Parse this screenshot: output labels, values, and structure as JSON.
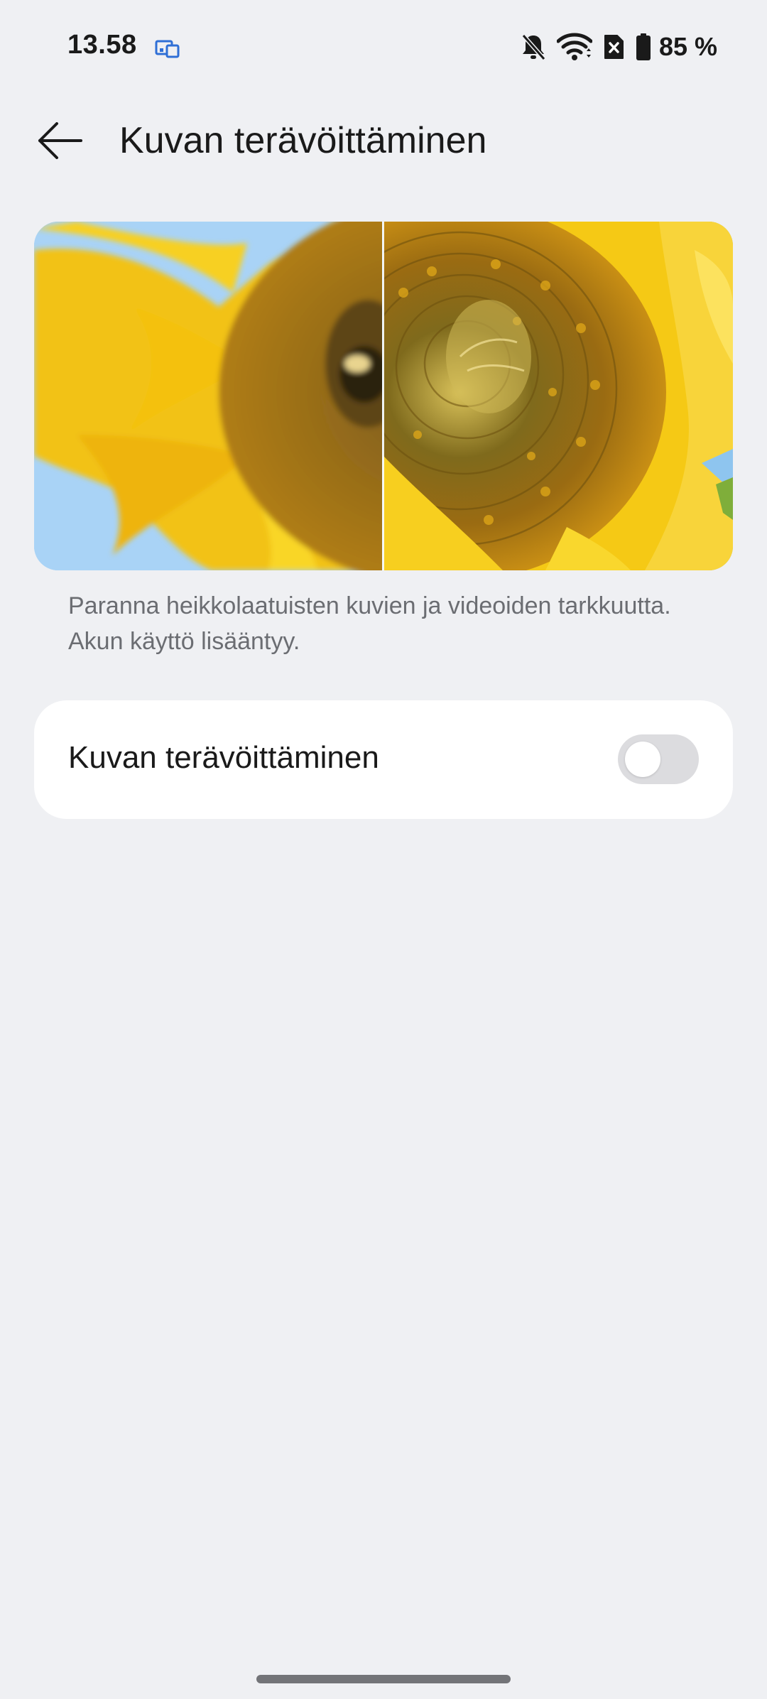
{
  "status_bar": {
    "time": "13.58",
    "left_icon": "screen-cast-icon",
    "right_icons": [
      "bell-off-icon",
      "wifi-icon",
      "sim-off-icon",
      "battery-icon"
    ],
    "battery_text": "85 %",
    "battery_level": 0.85
  },
  "header": {
    "back_icon": "arrow-left-icon",
    "title": "Kuvan terävöittäminen"
  },
  "preview": {
    "image": "sunflower-sharpening-comparison"
  },
  "description": "Paranna heikkolaatuisten kuvien ja videoiden tarkkuutta. Akun käyttö lisääntyy.",
  "setting": {
    "label": "Kuvan terävöittäminen",
    "enabled": false
  },
  "colors": {
    "background": "#eff0f3",
    "card": "#ffffff",
    "toggle_off": "#dcdcdf",
    "secondary_text": "#6b6d72",
    "status_accent": "#2f6fd6"
  }
}
